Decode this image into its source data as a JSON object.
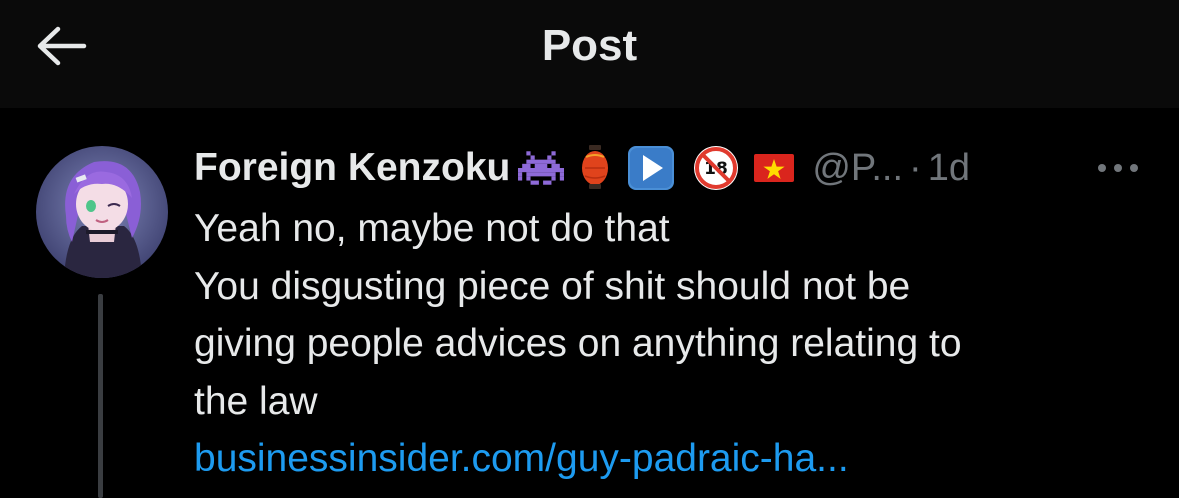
{
  "header": {
    "title": "Post",
    "back_icon": "arrow-left-icon"
  },
  "post": {
    "author": {
      "display_name": "Foreign Kenzoku",
      "name_emojis": [
        "alien-monster-icon",
        "red-lantern-icon",
        "play-button-icon",
        "no-under-18-icon",
        "vietnam-flag-icon"
      ],
      "handle": "@P...",
      "avatar_icon": "anime-avatar-icon"
    },
    "separator": "·",
    "time": "1d",
    "more_icon": "more-dots-icon",
    "text_lines": [
      "Yeah no, maybe not do that",
      "You disgusting piece of shit should not be",
      "giving people advices on anything relating to",
      "the law"
    ],
    "link": "businessinsider.com/guy-padraic-ha..."
  },
  "colors": {
    "background": "#000000",
    "header_bg": "#0a0a0a",
    "text": "#e7e9ea",
    "secondary": "#71767b",
    "link": "#1d9bf0"
  }
}
